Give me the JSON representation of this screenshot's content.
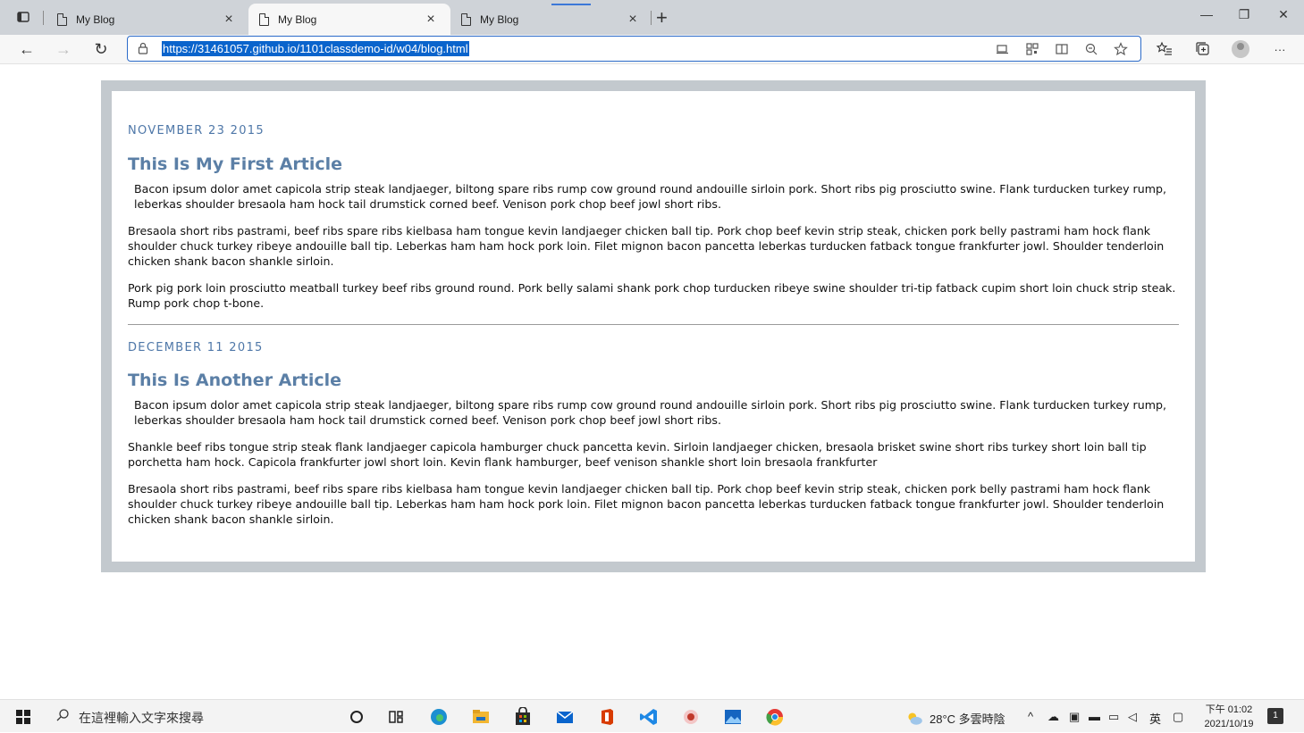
{
  "browser": {
    "tabs": [
      {
        "title": "My Blog",
        "close": "×",
        "active": false
      },
      {
        "title": "My Blog",
        "close": "×",
        "active": true
      },
      {
        "title": "My Blog",
        "close": "×",
        "active": false
      }
    ],
    "new_tab": "+",
    "window_controls": {
      "minimize": "—",
      "restore": "❐",
      "close": "✕"
    },
    "nav": {
      "back": "←",
      "forward": "→",
      "refresh": "↻"
    },
    "url": "https://31461057.github.io/1101classdemo-id/w04/blog.html",
    "toolbar_icons": [
      "read-aloud-icon",
      "qr-code-icon",
      "immersive-reader-icon",
      "zoom-icon",
      "add-favorite-icon",
      "favorites-icon",
      "collections-icon",
      "profile-icon",
      "more-icon"
    ],
    "more": "···"
  },
  "articles": [
    {
      "date": "NOVEMBER 23 2015",
      "title": "This Is My First Article",
      "paragraphs": [
        "Bacon ipsum dolor amet capicola strip steak landjaeger, biltong spare ribs rump cow ground round andouille sirloin pork. Short ribs pig prosciutto swine. Flank turducken turkey rump, leberkas shoulder bresaola ham hock tail drumstick corned beef. Venison pork chop beef jowl short ribs.",
        "Bresaola short ribs pastrami, beef ribs spare ribs kielbasa ham tongue kevin landjaeger chicken ball tip. Pork chop beef kevin strip steak, chicken pork belly pastrami ham hock flank shoulder chuck turkey ribeye andouille ball tip. Leberkas ham ham hock pork loin. Filet mignon bacon pancetta leberkas turducken fatback tongue frankfurter jowl. Shoulder tenderloin chicken shank bacon shankle sirloin.",
        "Pork pig pork loin prosciutto meatball turkey beef ribs ground round. Pork belly salami shank pork chop turducken ribeye swine shoulder tri-tip fatback cupim short loin chuck strip steak. Rump pork chop t-bone."
      ]
    },
    {
      "date": "DECEMBER 11 2015",
      "title": "This Is Another Article",
      "paragraphs": [
        "Bacon ipsum dolor amet capicola strip steak landjaeger, biltong spare ribs rump cow ground round andouille sirloin pork. Short ribs pig prosciutto swine. Flank turducken turkey rump, leberkas shoulder bresaola ham hock tail drumstick corned beef. Venison pork chop beef jowl short ribs.",
        "Shankle beef ribs tongue strip steak flank landjaeger capicola hamburger chuck pancetta kevin. Sirloin landjaeger chicken, bresaola brisket swine short ribs turkey short loin ball tip porchetta ham hock. Capicola frankfurter jowl short loin. Kevin flank hamburger, beef venison shankle short loin bresaola frankfurter",
        "Bresaola short ribs pastrami, beef ribs spare ribs kielbasa ham tongue kevin landjaeger chicken ball tip. Pork chop beef kevin strip steak, chicken pork belly pastrami ham hock flank shoulder chuck turkey ribeye andouille ball tip. Leberkas ham ham hock pork loin. Filet mignon bacon pancetta leberkas turducken fatback tongue frankfurter jowl. Shoulder tenderloin chicken shank bacon shankle sirloin."
      ]
    }
  ],
  "taskbar": {
    "search_placeholder": "在這裡輸入文字來搜尋",
    "apps": [
      {
        "name": "cortana-icon",
        "color": "#222222"
      },
      {
        "name": "task-view-icon",
        "color": "#222222"
      },
      {
        "name": "edge-icon",
        "color": "#1b8fd1"
      },
      {
        "name": "file-explorer-icon",
        "color": "#f2b632"
      },
      {
        "name": "store-icon",
        "color": "#2b2b2b"
      },
      {
        "name": "mail-icon",
        "color": "#0a64cc"
      },
      {
        "name": "office-icon",
        "color": "#d83b01"
      },
      {
        "name": "vscode-icon",
        "color": "#1e88e5"
      },
      {
        "name": "app-icon",
        "color": "#c0392b"
      },
      {
        "name": "photos-icon",
        "color": "#1565c0"
      },
      {
        "name": "chrome-icon",
        "color": "#e53935"
      }
    ],
    "weather": "28°C 多雲時陰",
    "ime": "英",
    "time": "下午 01:02",
    "date": "2021/10/19",
    "notifications": "1"
  }
}
